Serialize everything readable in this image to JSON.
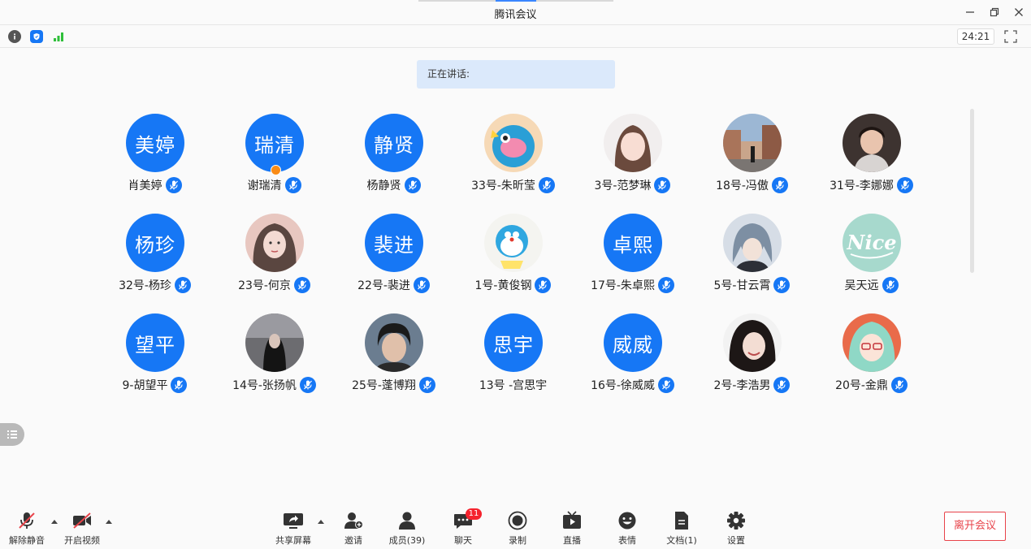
{
  "window": {
    "title": "腾讯会议"
  },
  "status": {
    "timer": "24:21"
  },
  "speaking": {
    "label": "正在讲话:"
  },
  "participants": [
    {
      "name": "肖美婷",
      "avatar_text": "美婷",
      "avatar": "text"
    },
    {
      "name": "谢瑞清",
      "avatar_text": "瑞清",
      "avatar": "text",
      "host": true
    },
    {
      "name": "杨静贤",
      "avatar_text": "静贤",
      "avatar": "text"
    },
    {
      "name": "33号-朱昕莹",
      "avatar": "cartoon-fish-photo"
    },
    {
      "name": "3号-范梦琳",
      "avatar": "girl-portrait-photo"
    },
    {
      "name": "18号-冯傲",
      "avatar": "city-street-photo"
    },
    {
      "name": "31号-李娜娜",
      "avatar": "child-photo"
    },
    {
      "name": "32号-杨珍",
      "avatar_text": "杨珍",
      "avatar": "text"
    },
    {
      "name": "23号-何京",
      "avatar": "illustrated-girl-photo"
    },
    {
      "name": "22号-裴进",
      "avatar_text": "裴进",
      "avatar": "text"
    },
    {
      "name": "1号-黄俊钢",
      "avatar": "doraemon-photo"
    },
    {
      "name": "17号-朱卓熙",
      "avatar_text": "卓熙",
      "avatar": "text"
    },
    {
      "name": "5号-甘云霄",
      "avatar": "anime-boy-photo"
    },
    {
      "name": "吴天远",
      "avatar": "nice-logo"
    },
    {
      "name": "9-胡望平",
      "avatar_text": "望平",
      "avatar": "text"
    },
    {
      "name": "14号-张扬帆",
      "avatar": "dark-girl-photo"
    },
    {
      "name": "25号-蓬博翔",
      "avatar": "man-portrait-photo"
    },
    {
      "name": "13号 -宫思宇",
      "avatar_text": "思宇",
      "avatar": "text",
      "no_mic": true
    },
    {
      "name": "16号-徐威威",
      "avatar_text": "威威",
      "avatar": "text"
    },
    {
      "name": "2号-李浩男",
      "avatar": "smiling-girl-photo"
    },
    {
      "name": "20号-金鼎",
      "avatar": "anime-girl-glasses-photo"
    }
  ],
  "toolbar": {
    "unmute": "解除静音",
    "start_video": "开启视频",
    "share_screen": "共享屏幕",
    "invite": "邀请",
    "members": "成员(39)",
    "chat": "聊天",
    "chat_badge": "11",
    "record": "录制",
    "live": "直播",
    "emoji": "表情",
    "docs": "文档(1)",
    "settings": "设置",
    "leave": "离开会议"
  },
  "colors": {
    "accent": "#1677f5",
    "danger": "#e8434a",
    "speaking_bg": "#dbe9fb"
  }
}
